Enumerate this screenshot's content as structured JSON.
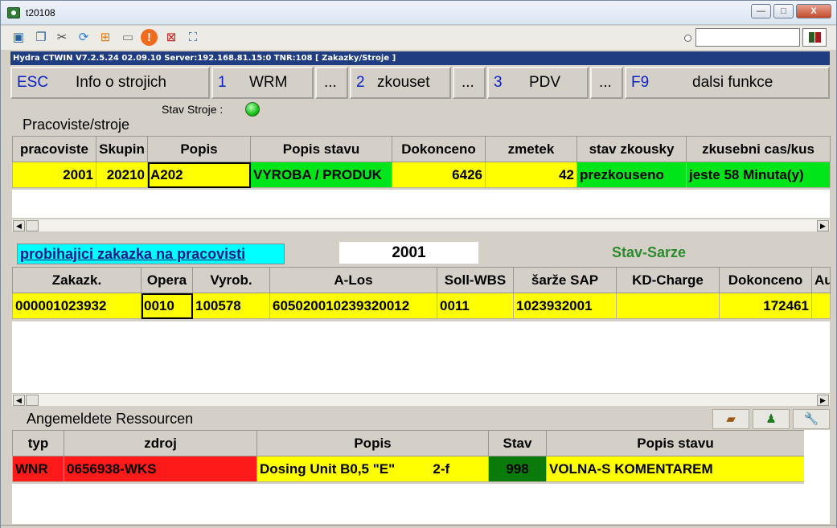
{
  "window": {
    "title": "t20108",
    "minimize": "—",
    "maximize": "□",
    "close": "X"
  },
  "toolbar": {
    "icons": [
      "monitor-icon",
      "windows-icon",
      "tools-icon",
      "refresh-icon",
      "windows-logo-icon",
      "drive-icon",
      "warning-icon",
      "network-error-icon",
      "fullscreen-icon"
    ],
    "search_value": ""
  },
  "status_line": "Hydra CTWIN V7.2.5.24  02.09.10  Server:192.168.81.15:0 TNR:108  [ Zakazky/Stroje ]",
  "fkeys": [
    {
      "key": "ESC",
      "label": "Info o strojich"
    },
    {
      "key": "1",
      "label": "WRM"
    },
    {
      "key": "",
      "label": "..."
    },
    {
      "key": "2",
      "label": "zkouset"
    },
    {
      "key": "",
      "label": "..."
    },
    {
      "key": "3",
      "label": "PDV"
    },
    {
      "key": "",
      "label": "..."
    },
    {
      "key": "F9",
      "label": "dalsi funkce"
    }
  ],
  "machines": {
    "title": "Pracoviste/stroje",
    "stav_label": "Stav Stroje :",
    "columns": [
      "pracoviste",
      "Skupin",
      "Popis",
      "Popis stavu",
      "Dokonceno",
      "zmetek",
      "stav zkousky",
      "zkusebni cas/kus"
    ],
    "rows": [
      [
        "2001",
        "20210",
        "A202",
        "VYROBA / PRODUK",
        "6426",
        "42",
        "prezkouseno",
        "jeste  58 Minuta(y)"
      ]
    ]
  },
  "orders": {
    "label": "probihajici zakazka na pracovisti",
    "workplace": "2001",
    "stav_sarze": "Stav-Sarze",
    "columns": [
      "Zakazk.",
      "Opera",
      "Vyrob.",
      "A-Los",
      "Soll-WBS",
      "šarže SAP",
      "KD-Charge",
      "Dokonceno",
      "Au"
    ],
    "rows": [
      [
        "000001023932",
        "0010",
        "100578",
        "605020010239320012",
        "0011",
        "1023932001",
        "",
        "172461",
        ""
      ]
    ]
  },
  "resources": {
    "title": "Angemeldete Ressourcen",
    "buttons": [
      "stack-icon",
      "person-icon",
      "wrench-icon"
    ],
    "columns": [
      "typ",
      "zdroj",
      "Popis",
      "Stav",
      "Popis stavu"
    ],
    "rows": [
      [
        "WNR",
        "0656938-WKS",
        "Dosing Unit B0,5 \"E\"          2-f",
        "998",
        "VOLNA-S KOMENTAREM"
      ]
    ]
  }
}
